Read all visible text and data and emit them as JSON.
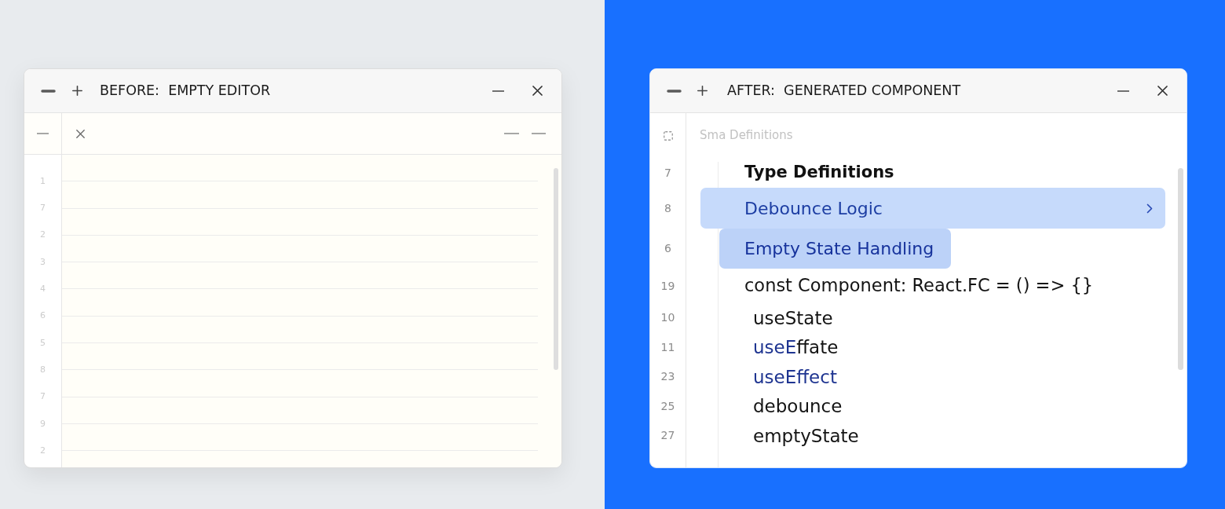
{
  "before": {
    "title": "BEFORE:  EMPTY EDITOR",
    "line_numbers": [
      "1",
      "7",
      "2",
      "3",
      "4",
      "6",
      "5",
      "8",
      "7",
      "9",
      "2"
    ]
  },
  "after": {
    "title": "AFTER:  GENERATED COMPONENT",
    "header": "Sma Definitions",
    "rows": [
      {
        "kind": "heading",
        "line": "7",
        "text": "Type Definitions"
      },
      {
        "kind": "suggestion",
        "line": "8",
        "text": "Debounce Logic",
        "selected": true
      },
      {
        "kind": "suggestion",
        "line": "6",
        "text": "Empty State Handling",
        "selected": false
      },
      {
        "kind": "code",
        "line": "19",
        "segments": [
          {
            "kind": "plain",
            "text": "const Component: React.FC = () => {}"
          }
        ],
        "children": [
          {
            "kind": "code",
            "line": "10",
            "segments": [
              {
                "kind": "plain",
                "text": "useState"
              }
            ]
          },
          {
            "kind": "code",
            "line": "11",
            "segments": [
              {
                "kind": "identifier",
                "text": "useE"
              },
              {
                "kind": "plain",
                "text": "ffate"
              }
            ]
          },
          {
            "kind": "code",
            "line": "23",
            "segments": [
              {
                "kind": "identifier",
                "text": "useEffect"
              }
            ]
          },
          {
            "kind": "code",
            "line": "25",
            "segments": [
              {
                "kind": "plain",
                "text": "debounce"
              }
            ]
          },
          {
            "kind": "code",
            "line": "27",
            "segments": [
              {
                "kind": "plain",
                "text": "emptyState"
              }
            ]
          }
        ]
      }
    ]
  }
}
